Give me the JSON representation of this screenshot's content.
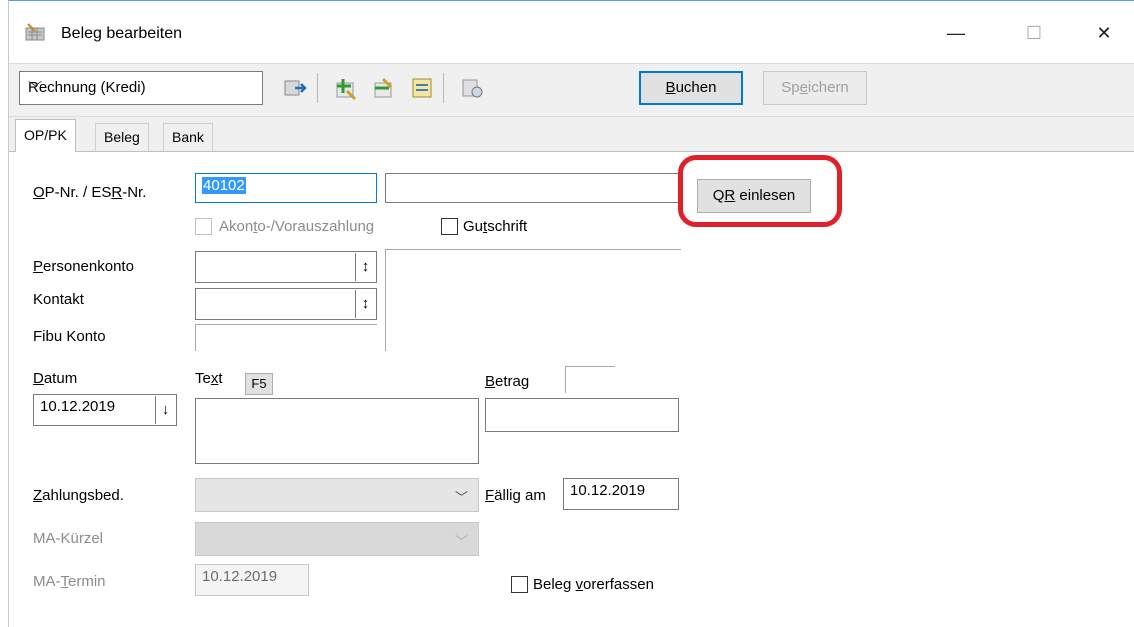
{
  "window": {
    "title": "Beleg bearbeiten",
    "minimize_glyph": "—",
    "maximize_glyph": "☐",
    "close_glyph": "✕"
  },
  "toolbar": {
    "doc_type": "Rechnung (Kredi)",
    "dropdown_arrow": "﹀",
    "buchen_label_u": "B",
    "buchen_label_rest": "uchen",
    "speichern_label_pre": "Sp",
    "speichern_label_u": "e",
    "speichern_label_rest": "ichern",
    "icons": [
      "import-icon",
      "add-green-icon",
      "remove-icon",
      "note-icon",
      "tools-icon"
    ]
  },
  "tabs": [
    {
      "label": "OP/PK",
      "active": true
    },
    {
      "label": "Beleg",
      "active": false
    },
    {
      "label": "Bank",
      "active": false
    }
  ],
  "form": {
    "op_nr_label_u": "O",
    "op_nr_label_mid": "P-Nr.  / ES",
    "op_nr_label_u2": "R",
    "op_nr_label_rest": "-Nr.",
    "op_nr_value": "40102",
    "esr_value": "",
    "qr_button_pre": "Q",
    "qr_button_u": "R",
    "qr_button_rest": " einlesen",
    "akonto_label_pre": "Akon",
    "akonto_label_u": "t",
    "akonto_label_rest": "o-/Vorauszahlung",
    "gutschrift_label_pre": "Gu",
    "gutschrift_label_u": "t",
    "gutschrift_label_rest": "schrift",
    "personenkonto_label_u": "P",
    "personenkonto_label_rest": "ersonenkonto",
    "kontakt_label": "Kontakt",
    "fibu_label": "Fibu Konto",
    "datum_label_u": "D",
    "datum_label_rest": "atum",
    "datum_value": "10.12.2019",
    "text_label_pre": "Te",
    "text_label_u": "x",
    "text_label_rest": "t",
    "f5_label": "F5",
    "betrag_label_u": "B",
    "betrag_label_rest": "etrag",
    "zahlungsbed_label_u": "Z",
    "zahlungsbed_label_rest": "ahlungsbed.",
    "faellig_label_u": "F",
    "faellig_label_rest": "ällig am",
    "faellig_value": "10.12.2019",
    "ma_kuerzel_label": "MA-Kürzel",
    "ma_termin_label_pre": "MA-",
    "ma_termin_label_u": "T",
    "ma_termin_label_rest": "ermin",
    "ma_termin_value": "10.12.2019",
    "vorerfassen_label_pre": "Beleg ",
    "vorerfassen_label_u": "v",
    "vorerfassen_label_rest": "orerfassen",
    "spin_updown": "↕",
    "spin_down": "↓"
  },
  "colors": {
    "highlight_ring": "#e0202a",
    "focus_border": "#0078d7",
    "selection": "#3399ff"
  }
}
